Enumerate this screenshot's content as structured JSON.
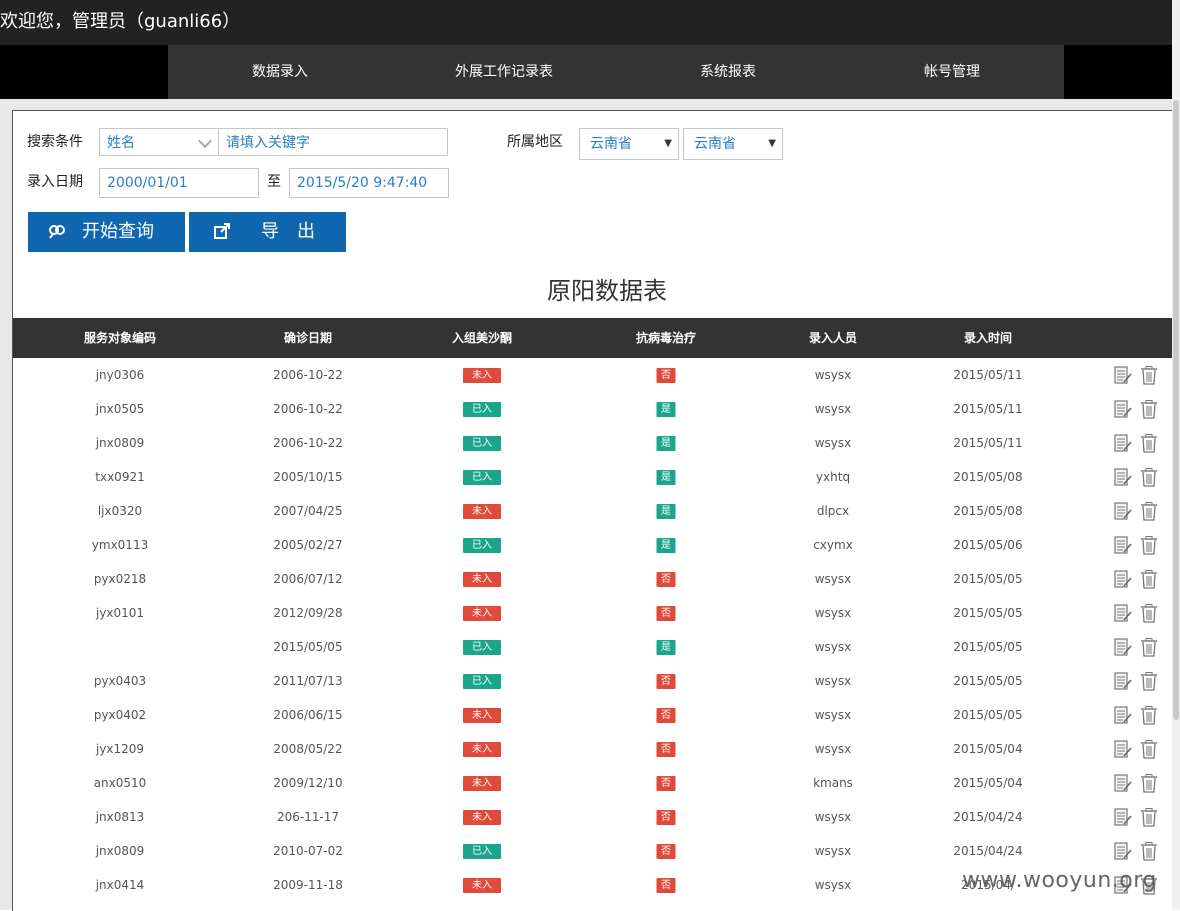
{
  "header": {
    "welcome": "欢迎您，管理员（guanli66）"
  },
  "nav": {
    "items": [
      {
        "label": "数据录入"
      },
      {
        "label": "外展工作记录表"
      },
      {
        "label": "系统报表"
      },
      {
        "label": "帐号管理"
      }
    ]
  },
  "search": {
    "condition_label": "搜索条件",
    "field_select": "姓名",
    "keyword_placeholder": "请填入关键字",
    "region_label": "所属地区",
    "region1": "云南省",
    "region2": "云南省",
    "date_label": "录入日期",
    "date_from": "2000/01/01",
    "date_to_label": "至",
    "date_to": "2015/5/20 9:47:40"
  },
  "buttons": {
    "query": "开始查询",
    "export": "导　出"
  },
  "table": {
    "title": "原阳数据表",
    "headers": [
      "服务对象编码",
      "确诊日期",
      "入组美沙酮",
      "抗病毒治疗",
      "录入人员",
      "录入时间"
    ],
    "rows": [
      {
        "code": "jny0306",
        "date": "2006-10-22",
        "enrolled": "未入",
        "antiviral": "否",
        "staff": "wsysx",
        "time": "2015/05/11"
      },
      {
        "code": "jnx0505",
        "date": "2006-10-22",
        "enrolled": "已入",
        "antiviral": "是",
        "staff": "wsysx",
        "time": "2015/05/11"
      },
      {
        "code": "jnx0809",
        "date": "2006-10-22",
        "enrolled": "已入",
        "antiviral": "是",
        "staff": "wsysx",
        "time": "2015/05/11"
      },
      {
        "code": "txx0921",
        "date": "2005/10/15",
        "enrolled": "已入",
        "antiviral": "是",
        "staff": "yxhtq",
        "time": "2015/05/08"
      },
      {
        "code": "ljx0320",
        "date": "2007/04/25",
        "enrolled": "未入",
        "antiviral": "是",
        "staff": "dlpcx",
        "time": "2015/05/08"
      },
      {
        "code": "ymx0113",
        "date": "2005/02/27",
        "enrolled": "已入",
        "antiviral": "是",
        "staff": "cxymx",
        "time": "2015/05/06"
      },
      {
        "code": "pyx0218",
        "date": "2006/07/12",
        "enrolled": "未入",
        "antiviral": "否",
        "staff": "wsysx",
        "time": "2015/05/05"
      },
      {
        "code": "jyx0101",
        "date": "2012/09/28",
        "enrolled": "未入",
        "antiviral": "否",
        "staff": "wsysx",
        "time": "2015/05/05"
      },
      {
        "code": "",
        "date": "2015/05/05",
        "enrolled": "已入",
        "antiviral": "是",
        "staff": "wsysx",
        "time": "2015/05/05"
      },
      {
        "code": "pyx0403",
        "date": "2011/07/13",
        "enrolled": "已入",
        "antiviral": "否",
        "staff": "wsysx",
        "time": "2015/05/05"
      },
      {
        "code": "pyx0402",
        "date": "2006/06/15",
        "enrolled": "未入",
        "antiviral": "否",
        "staff": "wsysx",
        "time": "2015/05/05"
      },
      {
        "code": "jyx1209",
        "date": "2008/05/22",
        "enrolled": "未入",
        "antiviral": "否",
        "staff": "wsysx",
        "time": "2015/05/04"
      },
      {
        "code": "anx0510",
        "date": "2009/12/10",
        "enrolled": "未入",
        "antiviral": "否",
        "staff": "kmans",
        "time": "2015/05/04"
      },
      {
        "code": "jnx0813",
        "date": "206-11-17",
        "enrolled": "未入",
        "antiviral": "否",
        "staff": "wsysx",
        "time": "2015/04/24"
      },
      {
        "code": "jnx0809",
        "date": "2010-07-02",
        "enrolled": "已入",
        "antiviral": "否",
        "staff": "wsysx",
        "time": "2015/04/24"
      },
      {
        "code": "jnx0414",
        "date": "2009-11-18",
        "enrolled": "未入",
        "antiviral": "否",
        "staff": "wsysx",
        "time": "2015/04/"
      }
    ]
  },
  "colors": {
    "yes_badge": "#1aa58c",
    "no_badge": "#e04a3a",
    "button": "#1166b0",
    "header_bg": "#333333"
  },
  "icons": {
    "edit": "edit-icon",
    "delete": "trash-icon",
    "query": "search-icon",
    "export": "export-icon"
  },
  "watermark": "www.wooyun.org"
}
